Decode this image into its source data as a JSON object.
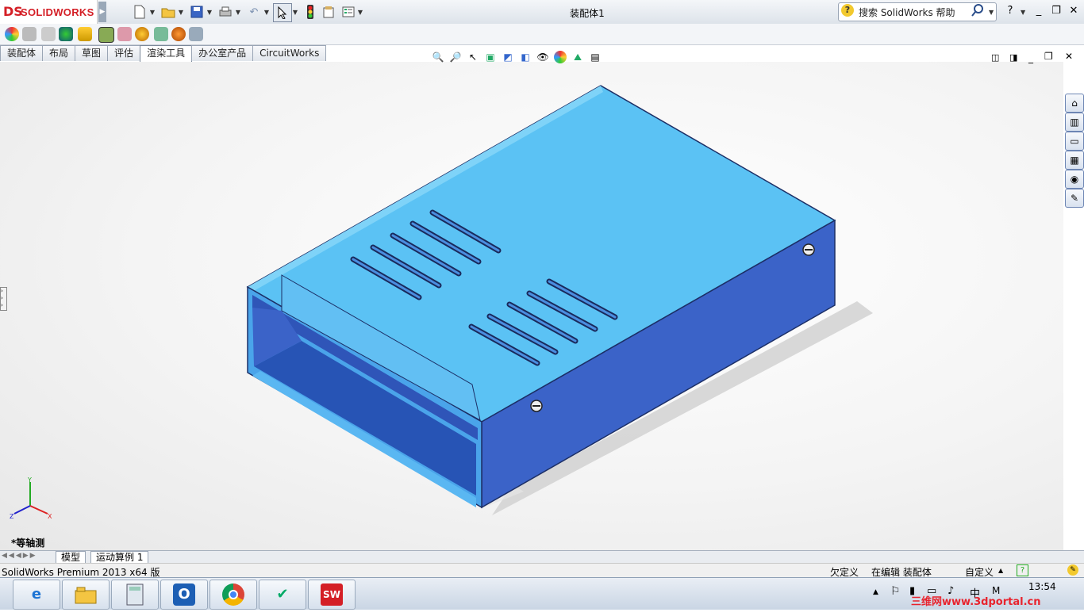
{
  "app": {
    "logo_mark": "DS",
    "logo_text": "SOLIDWORKS",
    "document_title": "装配体1"
  },
  "help": {
    "search_text": "搜索 SolidWorks 帮助",
    "help_glyph": "?"
  },
  "tabs": [
    {
      "label": "装配体"
    },
    {
      "label": "布局"
    },
    {
      "label": "草图"
    },
    {
      "label": "评估"
    },
    {
      "label": "渲染工具"
    },
    {
      "label": "办公室产品"
    },
    {
      "label": "CircuitWorks"
    }
  ],
  "active_tab": "渲染工具",
  "viewport": {
    "view_name": "*等轴测",
    "triad": {
      "x": "X",
      "y": "Y",
      "z": "Z"
    }
  },
  "bottom_tabs": [
    {
      "label": "模型"
    },
    {
      "label": "运动算例 1"
    }
  ],
  "statusbar": {
    "product": "SolidWorks Premium 2013 x64 版",
    "state": "欠定义",
    "editing": "在编辑 装配体",
    "units": "自定义"
  },
  "taskbar": {
    "time": "13:54",
    "watermark": "三维网www.3dportal.cn",
    "app_icons": [
      "ie-icon",
      "explorer-icon",
      "calculator-icon",
      "outlook-icon",
      "chrome-icon",
      "lite-icon",
      "solidworks-icon"
    ]
  },
  "colors": {
    "box_top": "#5bc2f4",
    "box_side": "#3b63c8",
    "accent": "#d41f26"
  }
}
